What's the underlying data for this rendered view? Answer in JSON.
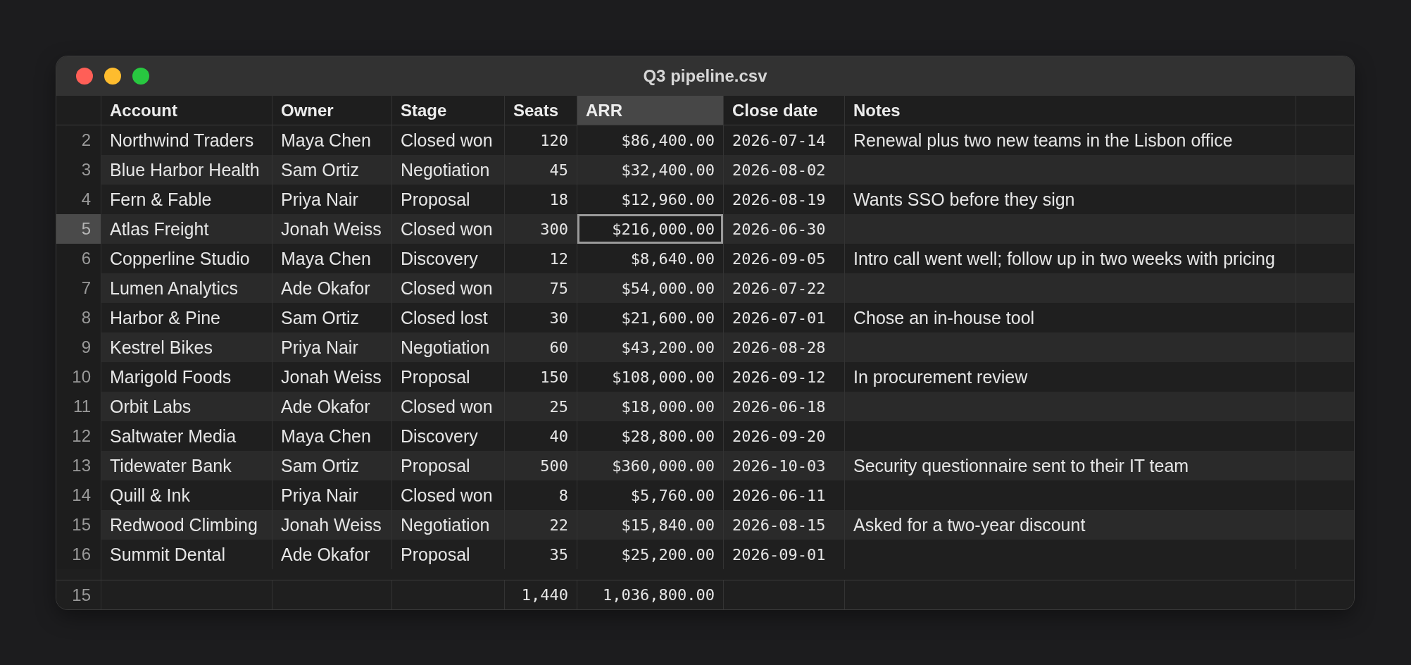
{
  "window": {
    "title": "Q3 pipeline.csv"
  },
  "table": {
    "columns": [
      {
        "label": "Account",
        "kind": "text",
        "selected": false
      },
      {
        "label": "Owner",
        "kind": "text",
        "selected": false
      },
      {
        "label": "Stage",
        "kind": "text",
        "selected": false
      },
      {
        "label": "Seats",
        "kind": "number",
        "selected": false,
        "total": "1,440"
      },
      {
        "label": "ARR",
        "kind": "number",
        "selected": true,
        "total": "1,036,800.00"
      },
      {
        "label": "Close date",
        "kind": "date",
        "selected": false
      },
      {
        "label": "Notes",
        "kind": "text",
        "selected": false
      }
    ],
    "rows": [
      {
        "number": "2",
        "selected": false,
        "cells": [
          "Northwind Traders",
          "Maya Chen",
          "Closed won",
          "120",
          "$86,400.00",
          "2026-07-14",
          "Renewal plus two new teams in the Lisbon office"
        ]
      },
      {
        "number": "3",
        "selected": false,
        "cells": [
          "Blue Harbor Health",
          "Sam Ortiz",
          "Negotiation",
          "45",
          "$32,400.00",
          "2026-08-02"
        ]
      },
      {
        "number": "4",
        "selected": false,
        "cells": [
          "Fern & Fable",
          "Priya Nair",
          "Proposal",
          "18",
          "$12,960.00",
          "2026-08-19",
          "Wants SSO before they sign"
        ]
      },
      {
        "number": "5",
        "selected": true,
        "cells": [
          "Atlas Freight",
          "Jonah Weiss",
          "Closed won",
          "300",
          "$216,000.00",
          "2026-06-30"
        ]
      },
      {
        "number": "6",
        "selected": false,
        "cells": [
          "Copperline Studio",
          "Maya Chen",
          "Discovery",
          "12",
          "$8,640.00",
          "2026-09-05",
          "Intro call went well; follow up in two weeks with pricing"
        ]
      },
      {
        "number": "7",
        "selected": false,
        "cells": [
          "Lumen Analytics",
          "Ade Okafor",
          "Closed won",
          "75",
          "$54,000.00",
          "2026-07-22"
        ]
      },
      {
        "number": "8",
        "selected": false,
        "cells": [
          "Harbor & Pine",
          "Sam Ortiz",
          "Closed lost",
          "30",
          "$21,600.00",
          "2026-07-01",
          "Chose an in-house tool"
        ]
      },
      {
        "number": "9",
        "selected": false,
        "cells": [
          "Kestrel Bikes",
          "Priya Nair",
          "Negotiation",
          "60",
          "$43,200.00",
          "2026-08-28"
        ]
      },
      {
        "number": "10",
        "selected": false,
        "cells": [
          "Marigold Foods",
          "Jonah Weiss",
          "Proposal",
          "150",
          "$108,000.00",
          "2026-09-12",
          "In procurement review"
        ]
      },
      {
        "number": "11",
        "selected": false,
        "cells": [
          "Orbit Labs",
          "Ade Okafor",
          "Closed won",
          "25",
          "$18,000.00",
          "2026-06-18"
        ]
      },
      {
        "number": "12",
        "selected": false,
        "cells": [
          "Saltwater Media",
          "Maya Chen",
          "Discovery",
          "40",
          "$28,800.00",
          "2026-09-20"
        ]
      },
      {
        "number": "13",
        "selected": false,
        "cells": [
          "Tidewater Bank",
          "Sam Ortiz",
          "Proposal",
          "500",
          "$360,000.00",
          "2026-10-03",
          "Security questionnaire sent to their IT team"
        ]
      },
      {
        "number": "14",
        "selected": false,
        "cells": [
          "Quill & Ink",
          "Priya Nair",
          "Closed won",
          "8",
          "$5,760.00",
          "2026-06-11"
        ]
      },
      {
        "number": "15",
        "selected": false,
        "cells": [
          "Redwood Climbing",
          "Jonah Weiss",
          "Negotiation",
          "22",
          "$15,840.00",
          "2026-08-15",
          "Asked for a two-year discount"
        ]
      },
      {
        "number": "16",
        "selected": false,
        "cells": [
          "Summit Dental",
          "Ade Okafor",
          "Proposal",
          "35",
          "$25,200.00",
          "2026-09-01"
        ]
      }
    ],
    "footer": {
      "row_count": "15"
    }
  }
}
